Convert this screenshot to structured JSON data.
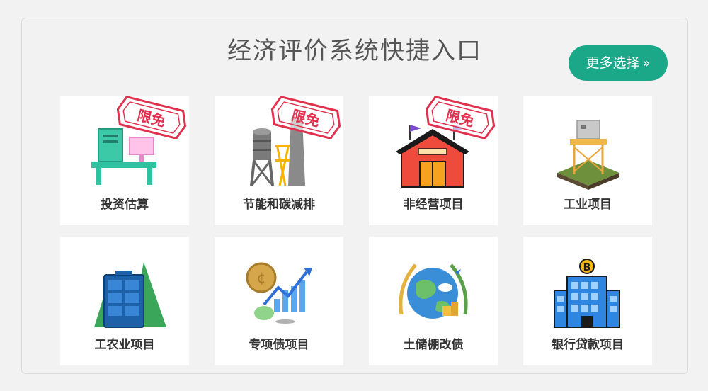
{
  "header": {
    "title": "经济评价系统快捷入口",
    "more_label": "更多选择",
    "more_chevron": "»"
  },
  "colors": {
    "accent": "#1aa889",
    "stamp": "#e0314f",
    "card_bg": "#ffffff",
    "page_bg": "#f2f2f2"
  },
  "stamp_text": "限免",
  "cards": [
    {
      "label": "投资估算",
      "icon": "computer-desk-icon",
      "free": true
    },
    {
      "label": "节能和碳减排",
      "icon": "factory-chimney-icon",
      "free": true
    },
    {
      "label": "非经营项目",
      "icon": "barn-building-icon",
      "free": true
    },
    {
      "label": "工业项目",
      "icon": "water-tower-icon",
      "free": false
    },
    {
      "label": "工农业项目",
      "icon": "solar-panel-trees-icon",
      "free": false
    },
    {
      "label": "专项债项目",
      "icon": "coin-growth-chart-icon",
      "free": false
    },
    {
      "label": "土储棚改债",
      "icon": "globe-wheat-icon",
      "free": false
    },
    {
      "label": "银行贷款项目",
      "icon": "bank-building-icon",
      "free": false
    }
  ]
}
